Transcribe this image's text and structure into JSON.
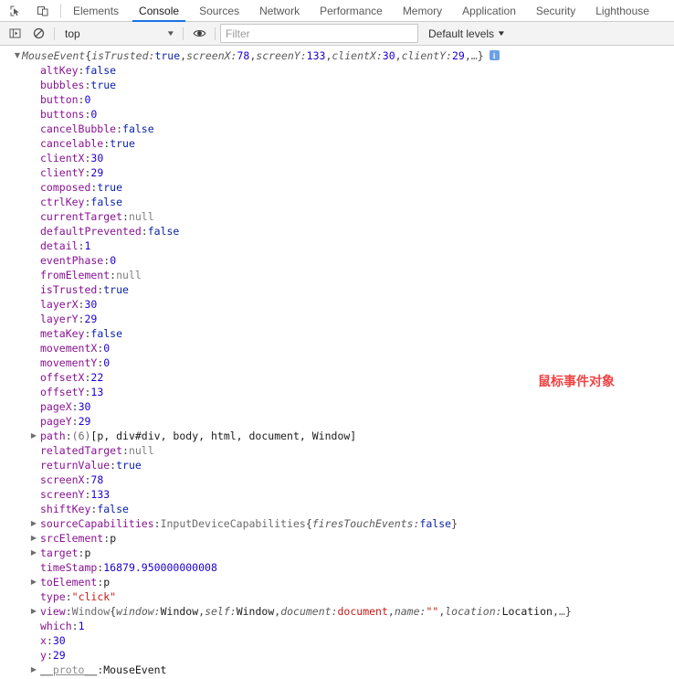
{
  "devtools": {
    "left_icons": [
      {
        "name": "inspect-element-icon",
        "glyph": "inspect"
      },
      {
        "name": "device-toolbar-icon",
        "glyph": "device"
      }
    ],
    "tabs": [
      {
        "label": "Elements",
        "active": false
      },
      {
        "label": "Console",
        "active": true
      },
      {
        "label": "Sources",
        "active": false
      },
      {
        "label": "Network",
        "active": false
      },
      {
        "label": "Performance",
        "active": false
      },
      {
        "label": "Memory",
        "active": false
      },
      {
        "label": "Application",
        "active": false
      },
      {
        "label": "Security",
        "active": false
      },
      {
        "label": "Lighthouse",
        "active": false
      }
    ]
  },
  "toolbar": {
    "sidebar_toggle_name": "console-sidebar-toggle-icon",
    "clear_console_name": "clear-console-icon",
    "context_value": "top",
    "eye_icon_name": "live-expression-eye-icon",
    "filter_placeholder": "Filter",
    "filter_value": "",
    "levels_label": "Default levels",
    "caret": "▼"
  },
  "annotation": {
    "text": "鼠标事件对象",
    "color": "#ee4444"
  },
  "console": {
    "header": {
      "constructor": "MouseEvent",
      "preview_open": "{",
      "preview": [
        {
          "key": "isTrusted",
          "value": "true",
          "type": "bool"
        },
        {
          "key": "screenX",
          "value": "78",
          "type": "num"
        },
        {
          "key": "screenY",
          "value": "133",
          "type": "num"
        },
        {
          "key": "clientX",
          "value": "30",
          "type": "num"
        },
        {
          "key": "clientY",
          "value": "29",
          "type": "num"
        }
      ],
      "ellipsis": "…",
      "preview_close": "}",
      "info_badge": "i",
      "triangle": "▼"
    },
    "properties": [
      {
        "key": "altKey",
        "value": "false",
        "type": "bool",
        "expandable": false
      },
      {
        "key": "bubbles",
        "value": "true",
        "type": "bool",
        "expandable": false
      },
      {
        "key": "button",
        "value": "0",
        "type": "num",
        "expandable": false
      },
      {
        "key": "buttons",
        "value": "0",
        "type": "num",
        "expandable": false
      },
      {
        "key": "cancelBubble",
        "value": "false",
        "type": "bool",
        "expandable": false
      },
      {
        "key": "cancelable",
        "value": "true",
        "type": "bool",
        "expandable": false
      },
      {
        "key": "clientX",
        "value": "30",
        "type": "num",
        "expandable": false
      },
      {
        "key": "clientY",
        "value": "29",
        "type": "num",
        "expandable": false
      },
      {
        "key": "composed",
        "value": "true",
        "type": "bool",
        "expandable": false
      },
      {
        "key": "ctrlKey",
        "value": "false",
        "type": "bool",
        "expandable": false
      },
      {
        "key": "currentTarget",
        "value": "null",
        "type": "null",
        "expandable": false
      },
      {
        "key": "defaultPrevented",
        "value": "false",
        "type": "bool",
        "expandable": false
      },
      {
        "key": "detail",
        "value": "1",
        "type": "num",
        "expandable": false
      },
      {
        "key": "eventPhase",
        "value": "0",
        "type": "num",
        "expandable": false
      },
      {
        "key": "fromElement",
        "value": "null",
        "type": "null",
        "expandable": false
      },
      {
        "key": "isTrusted",
        "value": "true",
        "type": "bool",
        "expandable": false
      },
      {
        "key": "layerX",
        "value": "30",
        "type": "num",
        "expandable": false
      },
      {
        "key": "layerY",
        "value": "29",
        "type": "num",
        "expandable": false
      },
      {
        "key": "metaKey",
        "value": "false",
        "type": "bool",
        "expandable": false
      },
      {
        "key": "movementX",
        "value": "0",
        "type": "num",
        "expandable": false
      },
      {
        "key": "movementY",
        "value": "0",
        "type": "num",
        "expandable": false
      },
      {
        "key": "offsetX",
        "value": "22",
        "type": "num",
        "expandable": false
      },
      {
        "key": "offsetY",
        "value": "13",
        "type": "num",
        "expandable": false
      },
      {
        "key": "pageX",
        "value": "30",
        "type": "num",
        "expandable": false
      },
      {
        "key": "pageY",
        "value": "29",
        "type": "num",
        "expandable": false
      },
      {
        "key": "path",
        "value": "(6) [p, div#div, body, html, document, Window]",
        "type": "array",
        "expandable": true
      },
      {
        "key": "relatedTarget",
        "value": "null",
        "type": "null",
        "expandable": false
      },
      {
        "key": "returnValue",
        "value": "true",
        "type": "bool",
        "expandable": false
      },
      {
        "key": "screenX",
        "value": "78",
        "type": "num",
        "expandable": false
      },
      {
        "key": "screenY",
        "value": "133",
        "type": "num",
        "expandable": false
      },
      {
        "key": "shiftKey",
        "value": "false",
        "type": "bool",
        "expandable": false
      },
      {
        "key": "sourceCapabilities",
        "value": "InputDeviceCapabilities {firesTouchEvents: false}",
        "type": "object",
        "expandable": true
      },
      {
        "key": "srcElement",
        "value": "p",
        "type": "node",
        "expandable": true
      },
      {
        "key": "target",
        "value": "p",
        "type": "node",
        "expandable": true
      },
      {
        "key": "timeStamp",
        "value": "16879.950000000008",
        "type": "num",
        "expandable": false
      },
      {
        "key": "toElement",
        "value": "p",
        "type": "node",
        "expandable": true
      },
      {
        "key": "type",
        "value": "\"click\"",
        "type": "str",
        "expandable": false
      },
      {
        "key": "view",
        "value": "Window {window: Window, self: Window, document: document, name: \"\", location: Location, …}",
        "type": "object",
        "expandable": true
      },
      {
        "key": "which",
        "value": "1",
        "type": "num",
        "expandable": false
      },
      {
        "key": "x",
        "value": "30",
        "type": "num",
        "expandable": false
      },
      {
        "key": "y",
        "value": "29",
        "type": "num",
        "expandable": false
      },
      {
        "key": "__proto__",
        "value": "MouseEvent",
        "type": "proto",
        "expandable": true
      }
    ]
  }
}
